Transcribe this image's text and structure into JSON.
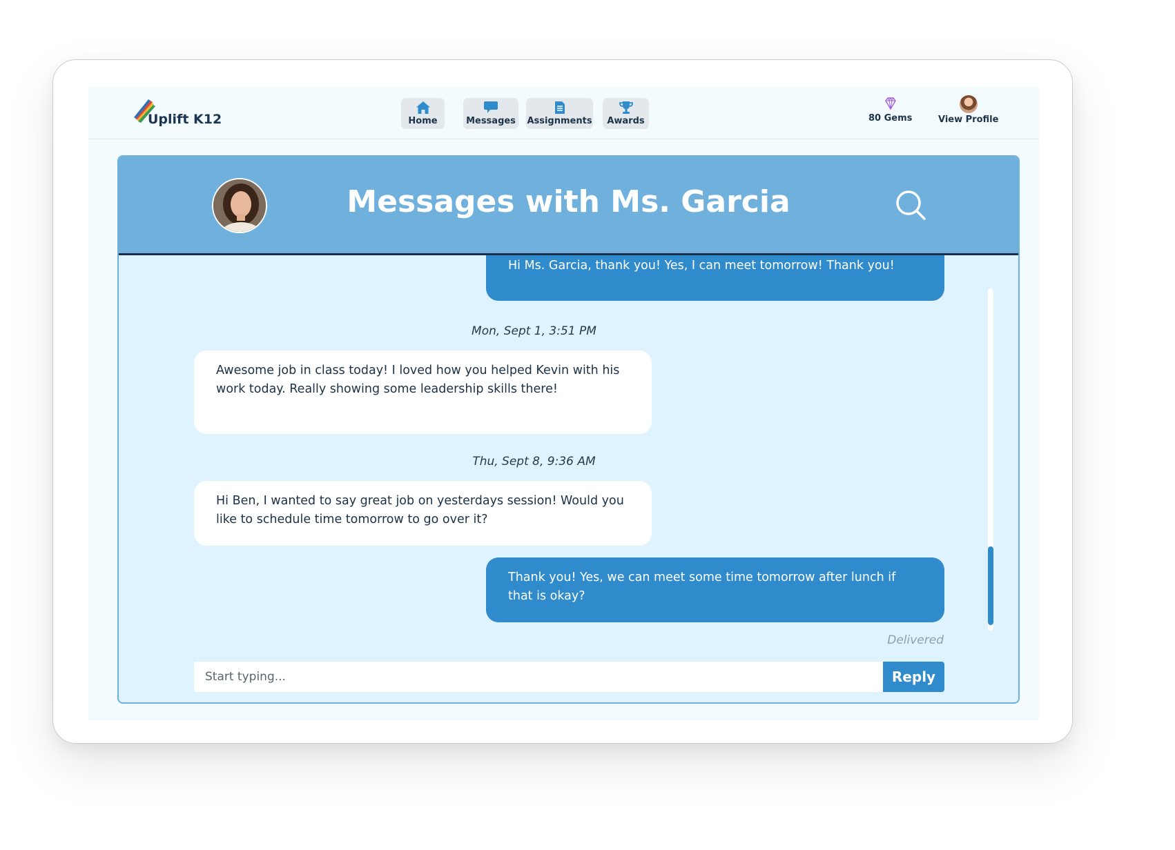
{
  "app": {
    "name": "Uplift K12"
  },
  "nav": {
    "home": "Home",
    "messages": "Messages",
    "assignments": "Assignments",
    "awards": "Awards"
  },
  "header_right": {
    "gems": "80 Gems",
    "profile": "View Profile"
  },
  "conversation": {
    "title": "Messages with Ms. Garcia",
    "messages": [
      {
        "direction": "sent",
        "text": "Hi Ms. Garcia, thank you! Yes, I can meet tomorrow! Thank you!"
      },
      {
        "timestamp": "Mon, Sept 1, 3:51 PM"
      },
      {
        "direction": "received",
        "text": "Awesome job in class today! I loved how you helped Kevin with his work today. Really showing some leadership skills there!"
      },
      {
        "timestamp": "Thu, Sept 8, 9:36 AM"
      },
      {
        "direction": "received",
        "text": "Hi Ben, I wanted to say great job on yesterdays session! Would you like to schedule time tomorrow to go over it?"
      },
      {
        "direction": "sent",
        "text": "Thank you! Yes, we can meet some time tomorrow after lunch if that is okay?"
      }
    ],
    "status": "Delivered"
  },
  "composer": {
    "placeholder": "Start typing...",
    "reply_label": "Reply"
  },
  "colors": {
    "primary": "#2f8bcb",
    "header": "#6fb1dc",
    "chat_bg": "#def3fd",
    "text_dark": "#1d3146"
  }
}
